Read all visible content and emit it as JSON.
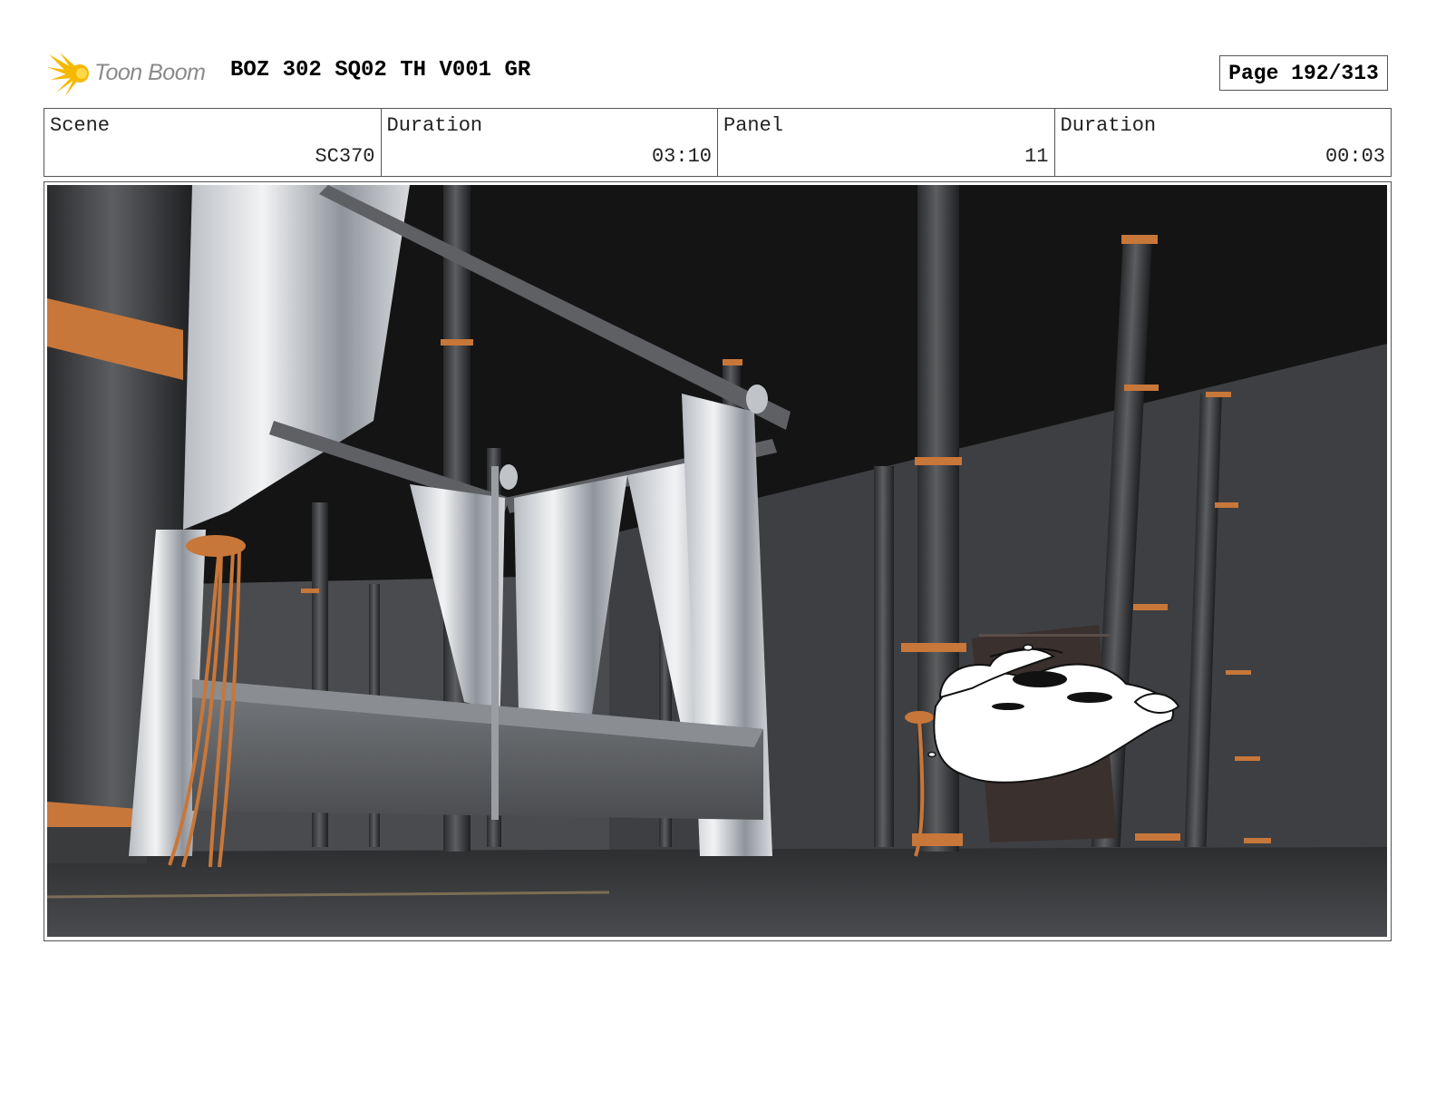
{
  "header": {
    "logo_text": "Toon Boom",
    "title": "BOZ 302 SQ02 TH V001 GR",
    "page": "Page 192/313"
  },
  "info": {
    "scene_label": "Scene",
    "scene_value": "SC370",
    "scene_duration_label": "Duration",
    "scene_duration_value": "03:10",
    "panel_label": "Panel",
    "panel_value": "11",
    "panel_duration_label": "Duration",
    "panel_duration_value": "00:03"
  },
  "colors": {
    "logo_yellow": "#f5b800",
    "copper": "#c8773a",
    "dark_bg": "#141414",
    "wall": "#3e3f42"
  }
}
